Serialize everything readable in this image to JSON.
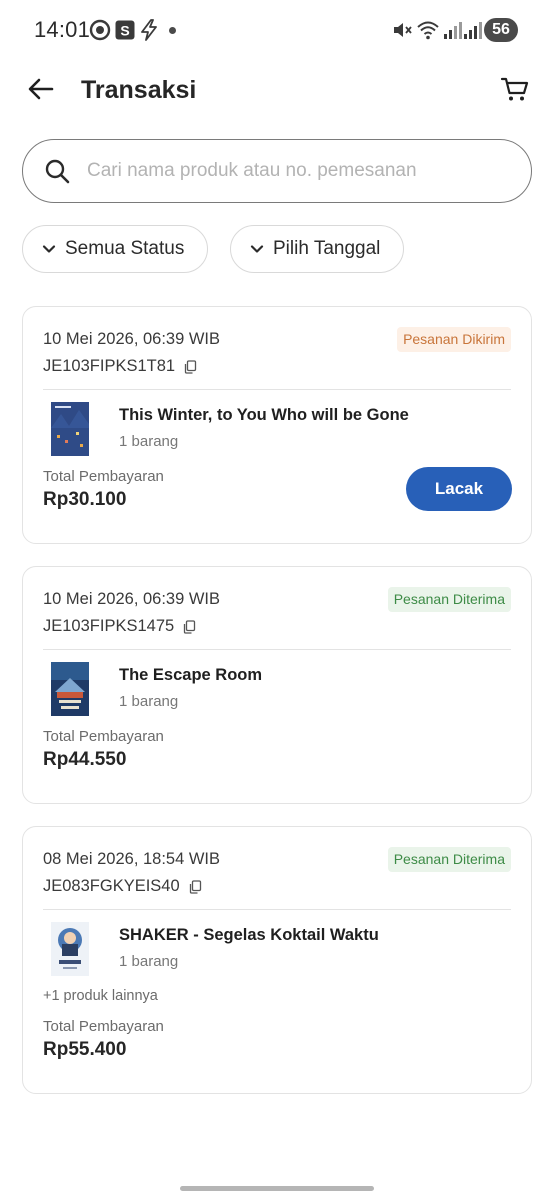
{
  "status_bar": {
    "time": "14:01",
    "battery": "56",
    "left_icons": [
      "github-icon",
      "s-app-icon",
      "bolt-icon",
      "notification-dot"
    ],
    "right_icons": [
      "mute-icon",
      "wifi-icon",
      "signal-icon",
      "signal-icon",
      "battery-icon"
    ]
  },
  "header": {
    "title": "Transaksi",
    "back_icon": "arrow-left-icon",
    "cart_icon": "cart-icon"
  },
  "search": {
    "placeholder": "Cari nama produk atau no. pemesanan",
    "value": ""
  },
  "filters": [
    {
      "label": "Semua Status",
      "icon": "chevron-down-icon"
    },
    {
      "label": "Pilih Tanggal",
      "icon": "chevron-down-icon"
    }
  ],
  "colors": {
    "primary_button": "#2860b8",
    "status_shipped_text": "#c8753a",
    "status_shipped_bg": "#fdf0e6",
    "status_received_text": "#3d8b46",
    "status_received_bg": "#eaf4ea"
  },
  "transactions": [
    {
      "date": "10 Mei 2026, 06:39 WIB",
      "order_no": "JE103FIPKS1T81",
      "status": "Pesanan Dikirim",
      "product_name": "This Winter, to You Who will be Gone",
      "quantity": "1 barang",
      "total_label": "Total Pembayaran",
      "total": "Rp30.100",
      "action": "Lacak"
    },
    {
      "date": "10 Mei 2026, 06:39 WIB",
      "order_no": "JE103FIPKS1475",
      "status": "Pesanan Diterima",
      "product_name": "The Escape Room",
      "quantity": "1 barang",
      "total_label": "Total Pembayaran",
      "total": "Rp44.550"
    },
    {
      "date": "08 Mei 2026, 18:54 WIB",
      "order_no": "JE083FGKYEIS40",
      "status": "Pesanan Diterima",
      "product_name": "SHAKER - Segelas Koktail Waktu",
      "quantity": "1 barang",
      "more_products": "+1 produk lainnya",
      "total_label": "Total Pembayaran",
      "total": "Rp55.400"
    }
  ]
}
